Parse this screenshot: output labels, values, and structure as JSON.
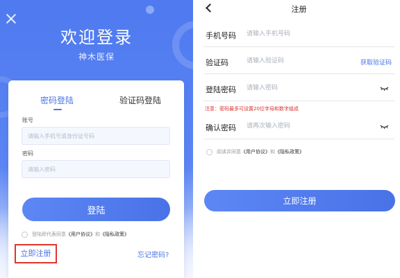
{
  "login": {
    "title": "欢迎登录",
    "app_name": "神木医保",
    "tabs": [
      {
        "label": "密码登陆",
        "active": true
      },
      {
        "label": "验证码登陆",
        "active": false
      }
    ],
    "account": {
      "label": "账号",
      "placeholder": "请输入手机号或身份证号码",
      "value": ""
    },
    "password": {
      "label": "密码",
      "placeholder": "请输入密码",
      "value": ""
    },
    "login_button": "登陆",
    "agreement": {
      "prefix": "登陆即代表同意",
      "user_agreement": "《用户协议》",
      "and": "和",
      "privacy_policy": "《隐私政策》"
    },
    "register_link": "立即注册",
    "forgot_password": "忘记密码?"
  },
  "register": {
    "title": "注册",
    "phone": {
      "label": "手机号码",
      "placeholder": "请输入手机号码",
      "value": ""
    },
    "code": {
      "label": "验证码",
      "placeholder": "请输入验证码",
      "value": "",
      "action": "获取验证码"
    },
    "password": {
      "label": "登陆密码",
      "placeholder": "请输入密码",
      "value": ""
    },
    "password_hint": "注意：密码最多可设置20位字母和数字组成",
    "confirm": {
      "label": "确认密码",
      "placeholder": "请再次输入密码",
      "value": ""
    },
    "agreement": {
      "prefix": "阅读并同意",
      "user_agreement": "《用户协议》",
      "and": "和",
      "privacy_policy": "《隐私政策》"
    },
    "register_button": "立即注册"
  },
  "colors": {
    "brand_blue": "#4b74e6",
    "highlight_red": "#e0342c",
    "hint_red": "#d9312a"
  }
}
